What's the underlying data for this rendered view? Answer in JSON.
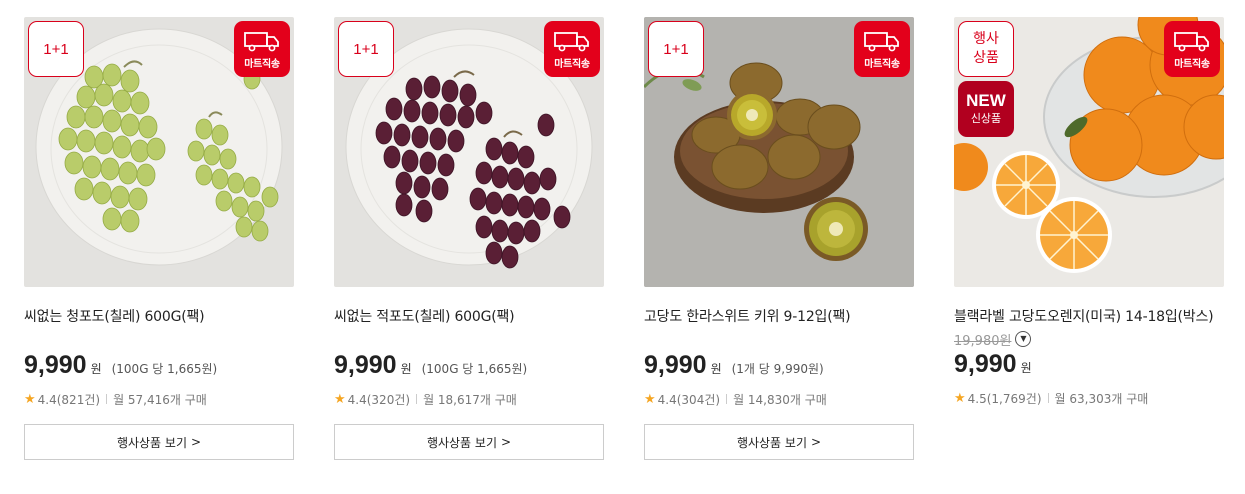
{
  "products": [
    {
      "badge": "1+1",
      "delivery_label": "마트직송",
      "name": "씨없는 청포도(칠레) 600G(팩)",
      "price": "9,990",
      "currency": "원",
      "unit_price": "(100G 당 1,665원)",
      "rating": "4.4(821건)",
      "monthly_sales": "월 57,416개 구매",
      "button_label": "행사상품 보기",
      "button_icon": ">",
      "image_icon": "green-grapes"
    },
    {
      "badge": "1+1",
      "delivery_label": "마트직송",
      "name": "씨없는 적포도(칠레) 600G(팩)",
      "price": "9,990",
      "currency": "원",
      "unit_price": "(100G 당 1,665원)",
      "rating": "4.4(320건)",
      "monthly_sales": "월 18,617개 구매",
      "button_label": "행사상품 보기",
      "button_icon": ">",
      "image_icon": "red-grapes"
    },
    {
      "badge": "1+1",
      "delivery_label": "마트직송",
      "name": "고당도 한라스위트 키위 9-12입(팩)",
      "price": "9,990",
      "currency": "원",
      "unit_price": "(1개 당 9,990원)",
      "rating": "4.4(304건)",
      "monthly_sales": "월 14,830개 구매",
      "button_label": "행사상품 보기",
      "button_icon": ">",
      "image_icon": "kiwi"
    },
    {
      "badge_line1": "행사",
      "badge_line2": "상품",
      "new_line1": "NEW",
      "new_line2": "신상품",
      "delivery_label": "마트직송",
      "name": "블랙라벨 고당도오렌지(미국) 14-18입(박스)",
      "original_price": "19,980원",
      "price": "9,990",
      "currency": "원",
      "rating": "4.5(1,769건)",
      "monthly_sales": "월 63,303개 구매",
      "image_icon": "oranges"
    }
  ],
  "colors": {
    "brand_red": "#e3001b",
    "star": "#f5a623"
  }
}
